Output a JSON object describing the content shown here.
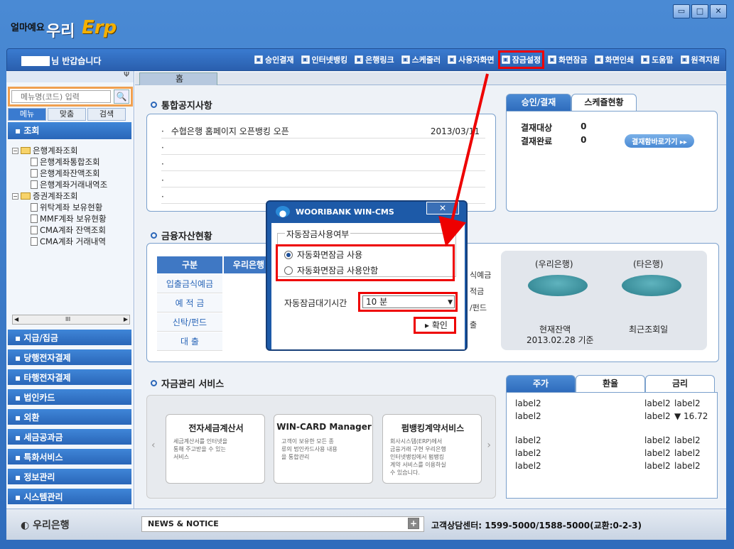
{
  "window": {
    "minimize": "▭",
    "restore": "□",
    "close": "✕"
  },
  "logo": {
    "t1": "얼마예요",
    "t2": "우리",
    "t3": "Erp"
  },
  "greeting": "님 반갑습니다",
  "toolbar": [
    {
      "label": "승인결재",
      "icon": "approve-icon"
    },
    {
      "label": "인터넷뱅킹",
      "icon": "internet-banking-icon"
    },
    {
      "label": "은행링크",
      "icon": "bank-link-icon"
    },
    {
      "label": "스케줄러",
      "icon": "scheduler-icon"
    },
    {
      "label": "사용자화면",
      "icon": "user-screen-icon"
    },
    {
      "label": "잠금설정",
      "icon": "lock-setting-icon"
    },
    {
      "label": "화면잠금",
      "icon": "screen-lock-icon"
    },
    {
      "label": "화면인쇄",
      "icon": "print-icon"
    },
    {
      "label": "도움말",
      "icon": "help-icon"
    },
    {
      "label": "원격지원",
      "icon": "remote-support-icon"
    }
  ],
  "left": {
    "pin": "Ψ",
    "search_placeholder": "메뉴명(코드) 입력",
    "tabs": [
      "메뉴",
      "맞춤",
      "검색"
    ],
    "section": "조회",
    "tree": [
      {
        "folder": "은행계좌조회",
        "items": [
          "은행계좌통합조회",
          "은행계좌잔액조회",
          "은행계좌거래내역조"
        ]
      },
      {
        "folder": "증권계좌조회",
        "items": [
          "위탁계좌 보유현황",
          "MMF계좌 보유현황",
          "CMA계좌 잔액조회",
          "CMA계좌 거래내역"
        ]
      }
    ],
    "scroll_mid": "III",
    "nav": [
      "지급/집금",
      "당행전자결제",
      "타행전자결제",
      "법인카드",
      "외환",
      "세금공과금",
      "특화서비스",
      "정보관리",
      "시스템관리"
    ]
  },
  "home_tab": "홈",
  "notice": {
    "title": "통합공지사항",
    "rows": [
      {
        "text": "수협은행 홈페이지 오픈뱅킹 오픈",
        "date": "2013/03/11"
      },
      {
        "text": "",
        "date": ""
      },
      {
        "text": "",
        "date": ""
      },
      {
        "text": "",
        "date": ""
      },
      {
        "text": "",
        "date": ""
      }
    ]
  },
  "approval": {
    "tabs": [
      "승인/결재",
      "스케쥴현황"
    ],
    "rows": [
      {
        "label": "결재대상",
        "value": "0"
      },
      {
        "label": "결재완료",
        "value": "0"
      }
    ],
    "go": "결재함바로가기 ▸▸"
  },
  "assets": {
    "title": "금융자산현황",
    "header": [
      "구분",
      "우리은행"
    ],
    "rows": [
      "입출금식예금",
      "예 적 금",
      "신탁/펀드",
      "대 출"
    ],
    "right_labels": [
      "식예금",
      "적금",
      "/펀드",
      "출"
    ],
    "ours": "(우리은행)",
    "others": "(타은행)",
    "ours_caption1": "현재잔액",
    "ours_caption2": "2013.02.28 기준",
    "others_caption": "최근조회일"
  },
  "services": {
    "title": "자금관리 서비스",
    "cards": [
      {
        "title": "전자세금계산서",
        "desc": "세금계산서를 인터넷을 통해 주고받을 수 있는 서비스"
      },
      {
        "title": "WIN-CARD Manager",
        "desc": "고객이 보유한 모든 종류의 법인카드사용 내용을 통합관리"
      },
      {
        "title": "펌뱅킹계약서비스",
        "desc": "회사시스템(ERP)에서 금융거래 구현 우리은행 인터넷뱅킹에서 펌뱅킹계약 서비스를 이용하실 수 있습니다."
      }
    ]
  },
  "rates": {
    "tabs": [
      "주가",
      "환율",
      "금리"
    ],
    "rows": [
      [
        "label2",
        "label2",
        "label2"
      ],
      [
        "label2",
        "label2",
        "▼ 16.72"
      ],
      [
        "label2",
        "label2",
        "label2"
      ],
      [
        "label2",
        "label2",
        "label2"
      ],
      [
        "label2",
        "label2",
        "label2"
      ]
    ]
  },
  "footer": {
    "brand": "우리은행",
    "news": "NEWS & NOTICE",
    "plus": "+",
    "call": "고객상담센터: 1599-5000/1588-5000(교환:0-2-3)"
  },
  "dialog": {
    "title": "WOORIBANK WIN-CMS",
    "close": "✕",
    "group": "자동잠금사용여부",
    "opt_on": "자동화면잠금 사용",
    "opt_off": "자동화면잠금 사용안함",
    "wait_label": "자동잠금대기시간",
    "wait_value": "10 분",
    "ok": "▸ 확인"
  },
  "colors": {
    "accent": "#2f6cbc",
    "highlight": "#e00000"
  }
}
